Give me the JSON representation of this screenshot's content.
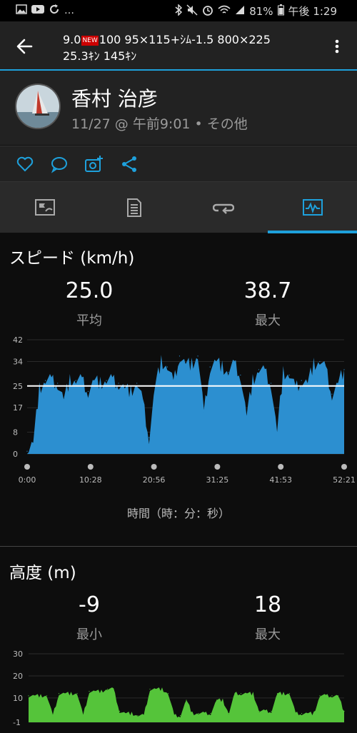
{
  "status_bar": {
    "battery": "81%",
    "time": "午後 1:29",
    "left_icons": [
      "image-icon",
      "youtube-icon",
      "sync-icon",
      "more-dots-icon"
    ],
    "right_icons": [
      "bluetooth-icon",
      "mute-icon",
      "alarm-icon",
      "wifi-icon",
      "signal-icon",
      "battery-icon"
    ]
  },
  "app_bar": {
    "title_line1_a": "9.0",
    "title_line1_badge": "NEW",
    "title_line1_b": "100 95×115+ｼﾑ-1.5  800×225",
    "title_line2": "25.3ｷﾝ 145ｷﾝ",
    "accent": "#1ea1dc"
  },
  "activity": {
    "user_name": "香村 治彦",
    "meta": "11/27 @ 午前9:01 • その他"
  },
  "actions": [
    "heart-icon",
    "comment-icon",
    "add-photo-icon",
    "share-icon"
  ],
  "tabs": [
    {
      "name": "summary",
      "icon": "flag-map-icon"
    },
    {
      "name": "details",
      "icon": "document-icon"
    },
    {
      "name": "laps",
      "icon": "loop-icon"
    },
    {
      "name": "charts",
      "icon": "chart-icon",
      "active": true
    }
  ],
  "speed": {
    "title": "スピード (km/h)",
    "avg_value": "25.0",
    "avg_label": "平均",
    "max_value": "38.7",
    "max_label": "最大",
    "x_axis_title": "時間（時：分：秒）"
  },
  "elevation": {
    "title": "高度 (m)",
    "min_value": "-9",
    "min_label": "最小",
    "max_value": "18",
    "max_label": "最大"
  },
  "chart_data": [
    {
      "type": "area",
      "title": "スピード (km/h)",
      "xlabel": "時間（時：分：秒）",
      "ylabel": "",
      "ylim": [
        0,
        42
      ],
      "y_ticks": [
        "0",
        "8",
        "17",
        "25",
        "34",
        "42"
      ],
      "x_ticks": [
        "0:00",
        "10:28",
        "20:56",
        "31:25",
        "41:53",
        "52:21"
      ],
      "average_line": 25,
      "color": "#2c8fd0",
      "x": [
        0,
        1,
        2,
        3,
        4,
        5,
        6,
        7,
        8,
        9,
        10,
        11,
        12,
        13,
        14,
        15,
        16,
        17,
        18,
        19,
        20,
        21,
        22,
        23,
        24,
        25,
        26,
        27,
        28,
        29,
        30,
        31,
        32,
        33,
        34,
        35,
        36,
        37,
        38,
        39,
        40,
        41,
        42,
        43,
        44,
        45,
        46,
        47,
        48,
        49,
        50,
        51,
        52
      ],
      "values": [
        1,
        4,
        24,
        27,
        27,
        26,
        20,
        27,
        27,
        27,
        23,
        27,
        26,
        27,
        27,
        26,
        24,
        23,
        26,
        19,
        6,
        25,
        34,
        32,
        26,
        36,
        33,
        33,
        36,
        15,
        32,
        34,
        32,
        30,
        33,
        29,
        14,
        27,
        31,
        30,
        26,
        8,
        30,
        29,
        24,
        27,
        26,
        33,
        34,
        31,
        22,
        26,
        31
      ]
    },
    {
      "type": "area",
      "title": "高度 (m)",
      "ylabel": "",
      "ylim": [
        -1,
        30
      ],
      "y_ticks": [
        "-1",
        "10",
        "20",
        "30"
      ],
      "color": "#55c43a",
      "x": [
        0,
        1,
        2,
        3,
        4,
        5,
        6,
        7,
        8,
        9,
        10,
        11,
        12,
        13,
        14,
        15,
        16,
        17,
        18,
        19,
        20,
        21,
        22,
        23,
        24,
        25,
        26,
        27,
        28,
        29,
        30,
        31,
        32,
        33,
        34,
        35,
        36,
        37,
        38,
        39,
        40,
        41,
        42,
        43,
        44,
        45,
        46,
        47,
        48,
        49,
        50,
        51,
        52
      ],
      "values": [
        11,
        11,
        11,
        11,
        2,
        12,
        12,
        12,
        12,
        2,
        13,
        13,
        13,
        14,
        14,
        4,
        3,
        3,
        2,
        2,
        14,
        14,
        14,
        12,
        2,
        2,
        9,
        3,
        3,
        3,
        3,
        9,
        9,
        3,
        12,
        12,
        12,
        12,
        4,
        4,
        4,
        12,
        12,
        12,
        3,
        3,
        3,
        3,
        11,
        11,
        11,
        11,
        4
      ]
    }
  ]
}
